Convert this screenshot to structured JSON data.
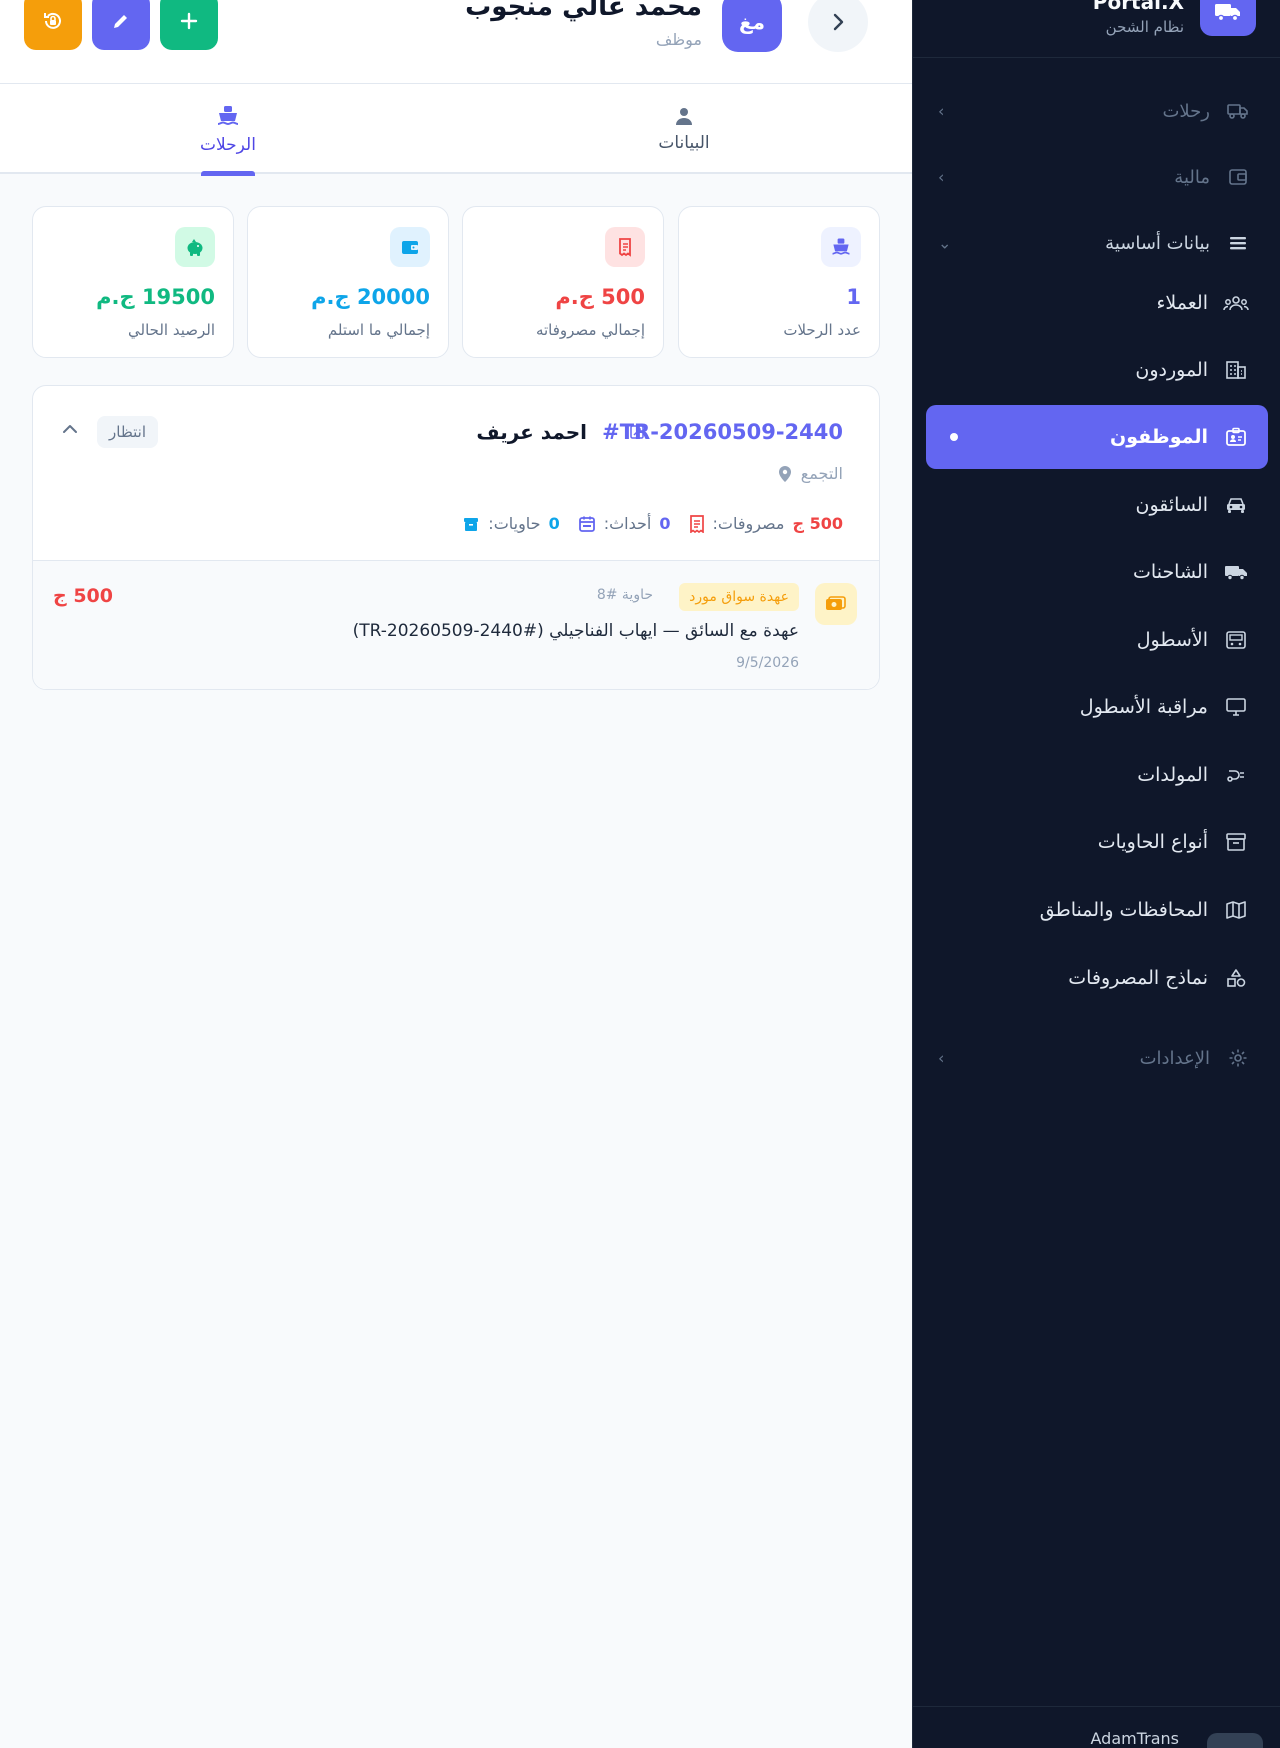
{
  "sidebar": {
    "brand_name": "Portal.X",
    "brand_sub": "نظام الشحن",
    "groups": {
      "trips": "رحلات",
      "finance": "مالية",
      "master": "بيانات أساسية",
      "settings": "الإعدادات"
    },
    "items": {
      "clients": "العملاء",
      "suppliers": "الموردون",
      "employees": "الموظفون",
      "drivers": "السائقون",
      "trucks": "الشاحنات",
      "fleet": "الأسطول",
      "fleet_monitor": "مراقبة الأسطول",
      "generators": "المولدات",
      "container_types": "أنواع الحاويات",
      "regions": "المحافظات والمناطق",
      "expense_templates": "نماذج المصروفات"
    },
    "footer_name": "AdamTrans"
  },
  "header": {
    "avatar_initials": "مغ",
    "name": "محمد غالي منجوب",
    "role": "موظف"
  },
  "tabs": {
    "info": "البيانات",
    "trips": "الرحلات"
  },
  "stats": {
    "trips_count": {
      "value": "1",
      "label": "عدد الرحلات"
    },
    "expenses": {
      "value": "500 ج.م",
      "label": "إجمالي مصروفاته"
    },
    "received": {
      "value": "20000 ج.م",
      "label": "إجمالي ما استلم"
    },
    "balance": {
      "value": "19500 ج.م",
      "label": "الرصيد الحالي"
    }
  },
  "trip": {
    "code": "#TR-20260509-2440",
    "driver": "احمد عريف",
    "status": "انتظار",
    "location": "التجمع",
    "containers_label": "حاويات:",
    "containers_value": "0",
    "events_label": "أحداث:",
    "events_value": "0",
    "expenses_label": "مصروفات:",
    "expenses_value": "500 ج",
    "tx": {
      "badge": "عهدة سواق مورد",
      "container": "حاوية #8",
      "description": "عهدة مع السائق — ايهاب الفناجيلي (#TR-20260509-2440)",
      "date": "9/5/2026",
      "amount": "500 ج"
    }
  },
  "colors": {
    "accent": "#6366f1",
    "sidebar_bg": "#0f172a",
    "green": "#10b981",
    "orange": "#f59e0b",
    "red": "#ef4444",
    "sky": "#0ea5e9"
  }
}
